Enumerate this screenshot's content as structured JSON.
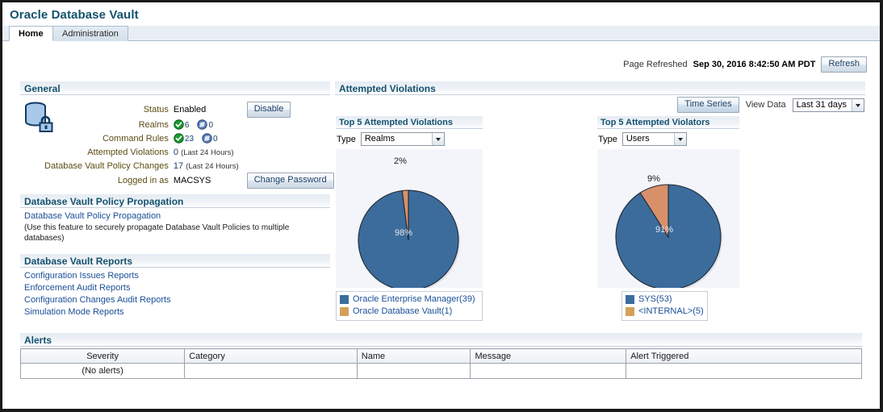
{
  "app": {
    "title": "Oracle Database Vault",
    "tabs": [
      {
        "label": "Home",
        "active": true
      },
      {
        "label": "Administration",
        "active": false
      }
    ]
  },
  "refresh": {
    "label": "Page Refreshed",
    "timestamp": "Sep 30, 2016 8:42:50 AM PDT",
    "button": "Refresh"
  },
  "general": {
    "heading": "General",
    "icon": "database-lock-icon",
    "rows": {
      "status_label": "Status",
      "status_value": "Enabled",
      "disable_button": "Disable",
      "realms_label": "Realms",
      "realms_enabled": "6",
      "realms_disabled": "0",
      "command_rules_label": "Command Rules",
      "command_rules_enabled": "23",
      "command_rules_disabled": "0",
      "attempted_violations_label": "Attempted Violations",
      "attempted_violations_value": "0",
      "attempted_violations_note": "(Last 24 Hours)",
      "policy_changes_label": "Database Vault Policy Changes",
      "policy_changes_value": "17",
      "policy_changes_note": "(Last 24 Hours)",
      "logged_in_label": "Logged in as",
      "logged_in_value": "MACSYS",
      "change_password_button": "Change Password"
    }
  },
  "propagation": {
    "heading": "Database Vault Policy Propagation",
    "link": "Database Vault Policy Propagation",
    "hint": "(Use this feature to securely propagate Database Vault Policies to multiple databases)"
  },
  "reports": {
    "heading": "Database Vault Reports",
    "links": [
      "Configuration Issues Reports",
      "Enforcement Audit Reports",
      "Configuration Changes Audit Reports",
      "Simulation Mode Reports"
    ]
  },
  "attempted_violations": {
    "heading": "Attempted Violations",
    "time_series_button": "Time Series",
    "view_data_label": "View Data",
    "view_data_value": "Last 31 days"
  },
  "charts": {
    "left": {
      "heading": "Top 5 Attempted Violations",
      "type_label": "Type",
      "type_value": "Realms"
    },
    "right": {
      "heading": "Top 5 Attempted Violators",
      "type_label": "Type",
      "type_value": "Users"
    }
  },
  "alerts": {
    "heading": "Alerts",
    "columns": [
      "Severity",
      "Category",
      "Name",
      "Message",
      "Alert Triggered"
    ],
    "rows": [
      {
        "severity": "(No alerts)",
        "category": "",
        "name": "",
        "message": "",
        "alert_triggered": ""
      }
    ]
  },
  "colors": {
    "series_blue": "#3b6c9c",
    "series_orange": "#d8906a",
    "legend_swatch_orange": "#d4a05c",
    "heading": "#14526e",
    "link": "#1a4f96"
  },
  "chart_data": [
    {
      "type": "pie",
      "title": "Top 5 Attempted Violations",
      "legend_position": "bottom-left",
      "labels": [
        "Oracle Enterprise Manager",
        "Oracle Database Vault"
      ],
      "legend_entries": [
        "Oracle Enterprise Manager(39)",
        "Oracle Database Vault(1)"
      ],
      "values": [
        39,
        1
      ],
      "percent_labels": [
        "98%",
        "2%"
      ],
      "percents": [
        98,
        2
      ],
      "colors": [
        "#3b6c9c",
        "#d8906a"
      ]
    },
    {
      "type": "pie",
      "title": "Top 5 Attempted Violators",
      "legend_position": "bottom-center",
      "labels": [
        "SYS",
        "<INTERNAL>"
      ],
      "legend_entries": [
        "SYS(53)",
        "<INTERNAL>(5)"
      ],
      "values": [
        53,
        5
      ],
      "percent_labels": [
        "91%",
        "9%"
      ],
      "percents": [
        91,
        9
      ],
      "colors": [
        "#3b6c9c",
        "#d8906a"
      ]
    }
  ]
}
